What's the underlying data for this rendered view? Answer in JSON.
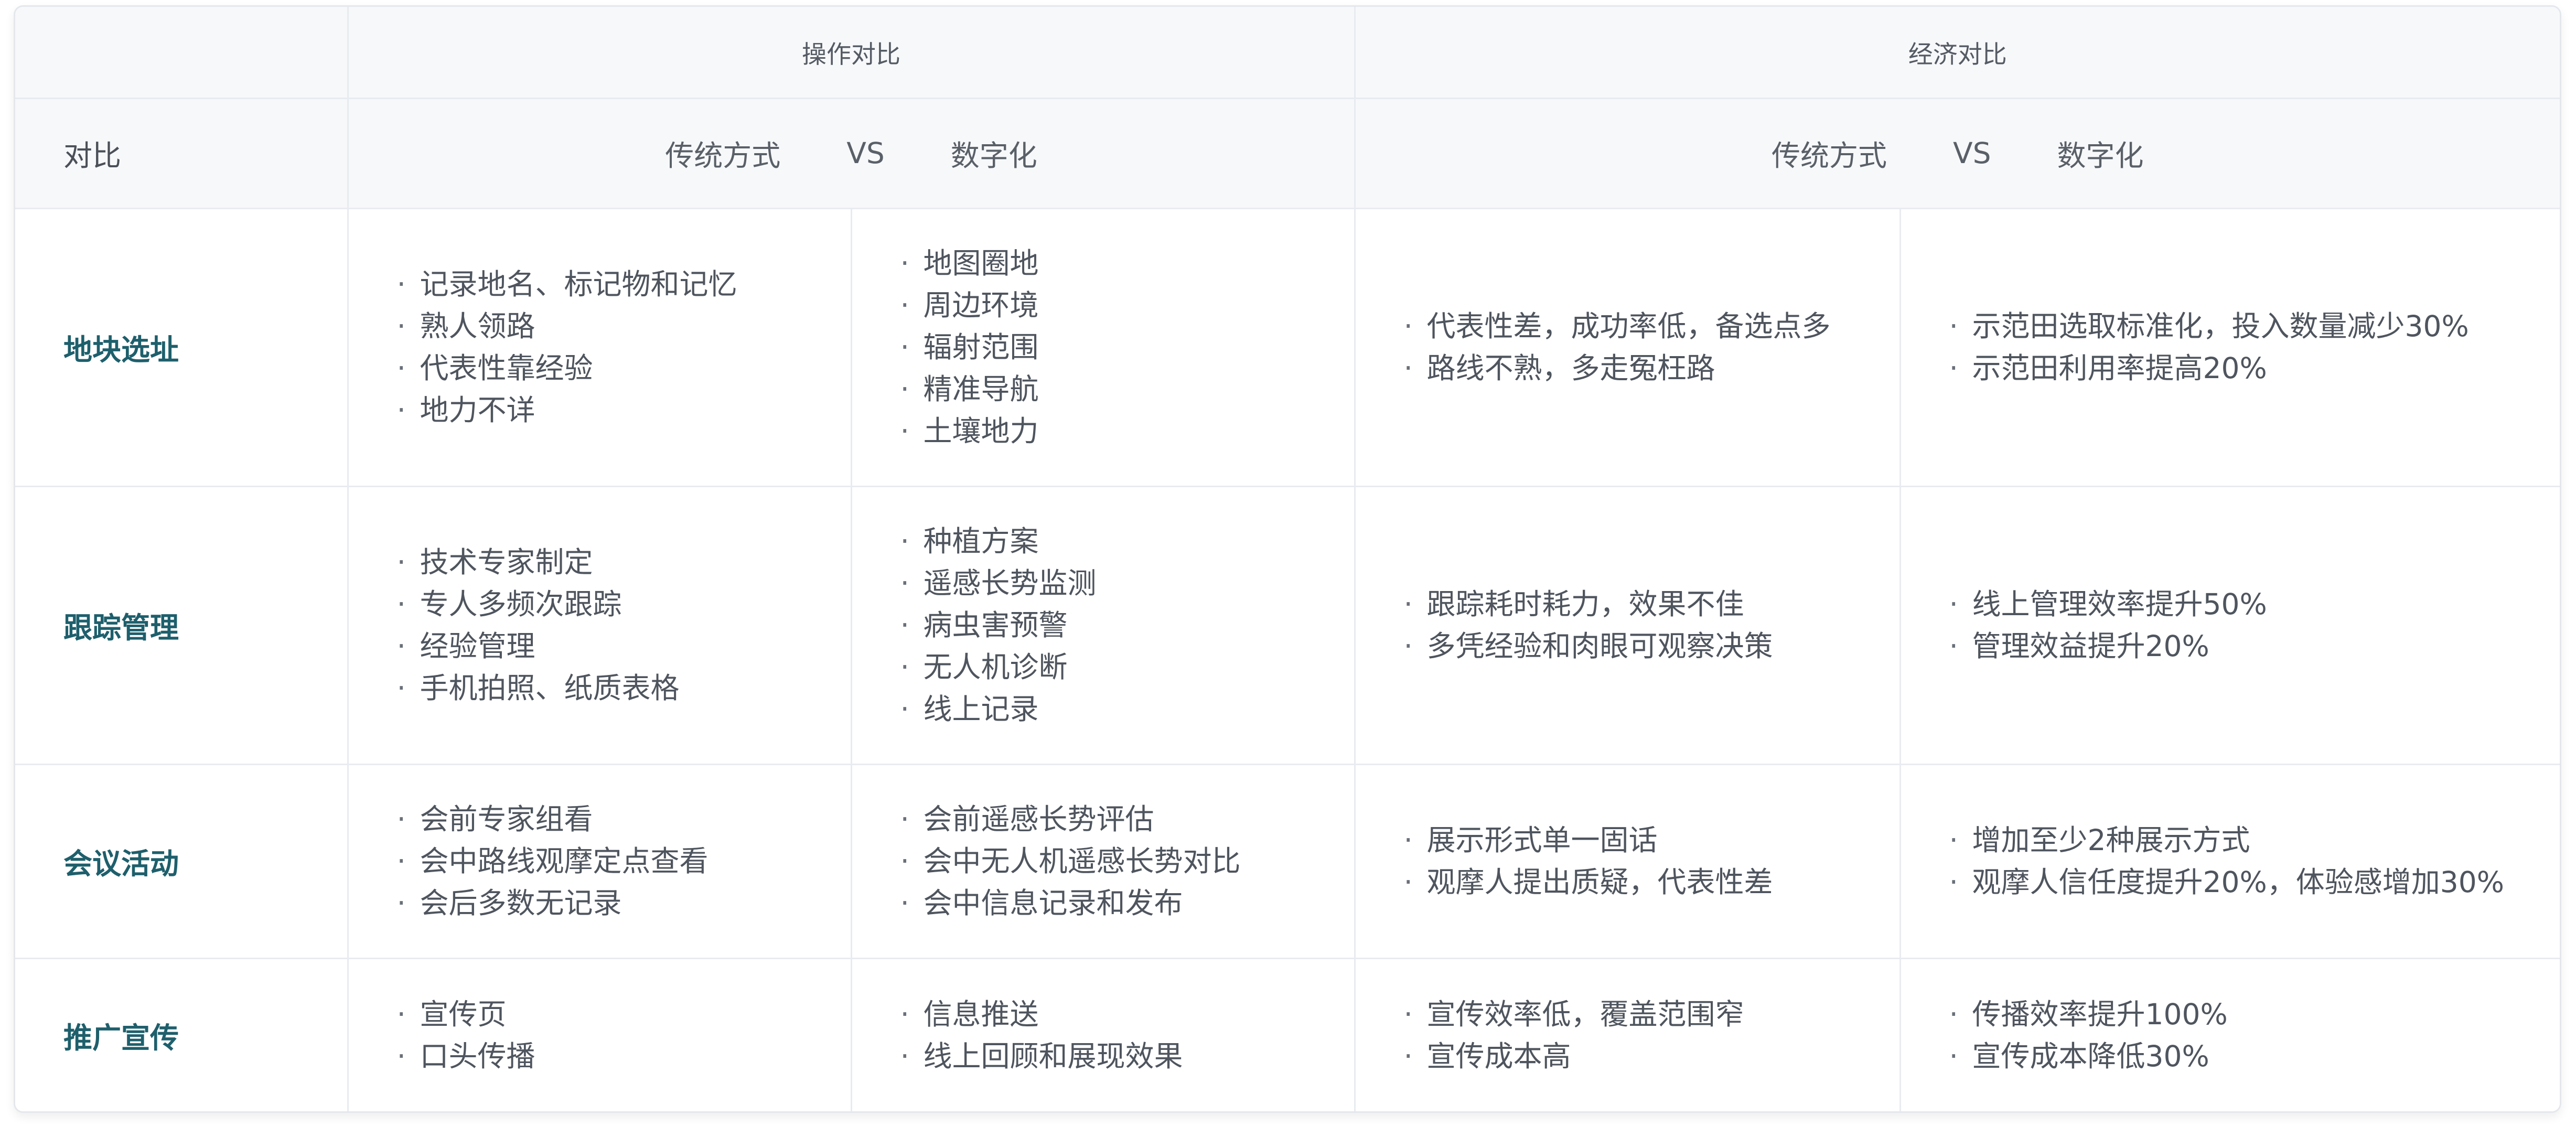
{
  "header": {
    "group_operation": "操作对比",
    "group_economic": "经济对比"
  },
  "subheader": {
    "label": "对比",
    "traditional": "传统方式",
    "vs": "VS",
    "digital": "数字化"
  },
  "rows": [
    {
      "category": "地块选址",
      "op_traditional": [
        "记录地名、标记物和记忆",
        "熟人领路",
        "代表性靠经验",
        "地力不详"
      ],
      "op_digital": [
        "地图圈地",
        "周边环境",
        "辐射范围",
        "精准导航",
        "土壤地力"
      ],
      "econ_traditional": [
        "代表性差，成功率低，备选点多",
        "路线不熟，多走冤枉路"
      ],
      "econ_digital": [
        "示范田选取标准化，投入数量减少30%",
        "示范田利用率提高20%"
      ]
    },
    {
      "category": "跟踪管理",
      "op_traditional": [
        "技术专家制定",
        "专人多频次跟踪",
        "经验管理",
        "手机拍照、纸质表格"
      ],
      "op_digital": [
        "种植方案",
        "遥感长势监测",
        "病虫害预警",
        "无人机诊断",
        "线上记录"
      ],
      "econ_traditional": [
        "跟踪耗时耗力，效果不佳",
        "多凭经验和肉眼可观察决策"
      ],
      "econ_digital": [
        "线上管理效率提升50%",
        "管理效益提升20%"
      ]
    },
    {
      "category": "会议活动",
      "op_traditional": [
        "会前专家组看",
        "会中路线观摩定点查看",
        "会后多数无记录"
      ],
      "op_digital": [
        "会前遥感长势评估",
        "会中无人机遥感长势对比",
        "会中信息记录和发布"
      ],
      "econ_traditional": [
        "展示形式单一固话",
        "观摩人提出质疑，代表性差"
      ],
      "econ_digital": [
        "增加至少2种展示方式",
        "观摩人信任度提升20%，体验感增加30%"
      ]
    },
    {
      "category": "推广宣传",
      "op_traditional": [
        "宣传页",
        "口头传播"
      ],
      "op_digital": [
        "信息推送",
        "线上回顾和展现效果"
      ],
      "econ_traditional": [
        "宣传效率低，覆盖范围窄",
        "宣传成本高"
      ],
      "econ_digital": [
        "传播效率提升100%",
        "宣传成本降低30%"
      ]
    }
  ]
}
